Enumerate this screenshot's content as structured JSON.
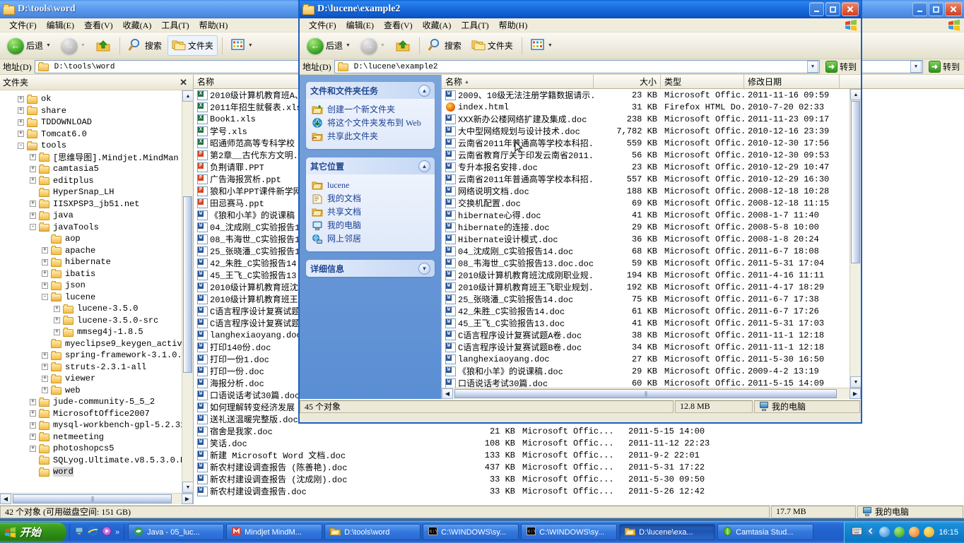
{
  "bg_window": {
    "title": "D:\\tools\\word",
    "menu": [
      "文件(F)",
      "编辑(E)",
      "查看(V)",
      "收藏(A)",
      "工具(T)",
      "帮助(H)"
    ],
    "toolbar": {
      "back": "后退",
      "search": "搜索",
      "folders": "文件夹"
    },
    "address": {
      "label": "地址(D)",
      "value": "D:\\tools\\word",
      "go": "转到"
    },
    "tree_header": "文件夹",
    "tree": [
      {
        "label": "ok",
        "indent": 1,
        "toggle": "+",
        "open": false
      },
      {
        "label": "share",
        "indent": 1,
        "toggle": "+",
        "open": false
      },
      {
        "label": "TDDOWNLOAD",
        "indent": 1,
        "toggle": "+",
        "open": false
      },
      {
        "label": "Tomcat6.0",
        "indent": 1,
        "toggle": "+",
        "open": false
      },
      {
        "label": "tools",
        "indent": 1,
        "toggle": "-",
        "open": true
      },
      {
        "label": "[思维导图].Mindjet.MindMan",
        "indent": 2,
        "toggle": "+",
        "open": false
      },
      {
        "label": "camtasia5",
        "indent": 2,
        "toggle": "+",
        "open": false
      },
      {
        "label": "editplus",
        "indent": 2,
        "toggle": "+",
        "open": false
      },
      {
        "label": "HyperSnap_LH",
        "indent": 2,
        "toggle": "",
        "open": false
      },
      {
        "label": "IISXPSP3_jb51.net",
        "indent": 2,
        "toggle": "+",
        "open": false
      },
      {
        "label": "java",
        "indent": 2,
        "toggle": "+",
        "open": false
      },
      {
        "label": "javaTools",
        "indent": 2,
        "toggle": "-",
        "open": true
      },
      {
        "label": "aop",
        "indent": 3,
        "toggle": "",
        "open": false
      },
      {
        "label": "apache",
        "indent": 3,
        "toggle": "+",
        "open": false
      },
      {
        "label": "hibernate",
        "indent": 3,
        "toggle": "+",
        "open": false
      },
      {
        "label": "ibatis",
        "indent": 3,
        "toggle": "+",
        "open": false
      },
      {
        "label": "json",
        "indent": 3,
        "toggle": "+",
        "open": false
      },
      {
        "label": "lucene",
        "indent": 3,
        "toggle": "-",
        "open": true
      },
      {
        "label": "lucene-3.5.0",
        "indent": 4,
        "toggle": "+",
        "open": false
      },
      {
        "label": "lucene-3.5.0-src",
        "indent": 4,
        "toggle": "+",
        "open": false
      },
      {
        "label": "mmseg4j-1.8.5",
        "indent": 4,
        "toggle": "+",
        "open": false
      },
      {
        "label": "myeclipse9_keygen_activ",
        "indent": 3,
        "toggle": "",
        "open": false
      },
      {
        "label": "spring-framework-3.1.0.",
        "indent": 3,
        "toggle": "+",
        "open": false
      },
      {
        "label": "struts-2.3.1-all",
        "indent": 3,
        "toggle": "+",
        "open": false
      },
      {
        "label": "viewer",
        "indent": 3,
        "toggle": "+",
        "open": false
      },
      {
        "label": "web",
        "indent": 3,
        "toggle": "+",
        "open": false
      },
      {
        "label": "jude-community-5_5_2",
        "indent": 2,
        "toggle": "+",
        "open": false
      },
      {
        "label": "MicrosoftOffice2007",
        "indent": 2,
        "toggle": "+",
        "open": false
      },
      {
        "label": "mysql-workbench-gpl-5.2.31",
        "indent": 2,
        "toggle": "+",
        "open": false
      },
      {
        "label": "netmeeting",
        "indent": 2,
        "toggle": "+",
        "open": false
      },
      {
        "label": "photoshopcs5",
        "indent": 2,
        "toggle": "+",
        "open": false
      },
      {
        "label": "SQLyog.Ultimate.v8.5.3.0.R",
        "indent": 2,
        "toggle": "",
        "open": false
      },
      {
        "label": "word",
        "indent": 2,
        "toggle": "",
        "open": false,
        "selected": true
      }
    ],
    "columns": {
      "name": "名称",
      "size": "大小",
      "type": "类型",
      "modified": "修改日期"
    },
    "files": [
      {
        "name": "2010级计算机教育班A、",
        "icon": "xls",
        "size": "",
        "type": "",
        "modified": ""
      },
      {
        "name": "2011年招生就餐表.xls",
        "icon": "xls",
        "size": "",
        "type": "",
        "modified": ""
      },
      {
        "name": "Book1.xls",
        "icon": "xls",
        "size": "",
        "type": "",
        "modified": ""
      },
      {
        "name": "学号.xls",
        "icon": "xls",
        "size": "",
        "type": "",
        "modified": ""
      },
      {
        "name": "昭通师范高等专科学校",
        "icon": "xls",
        "size": "",
        "type": "",
        "modified": ""
      },
      {
        "name": "第2章__古代东方文明.",
        "icon": "ppt",
        "size": "",
        "type": "",
        "modified": ""
      },
      {
        "name": "负荆请罪.PPT",
        "icon": "ppt",
        "size": "",
        "type": "",
        "modified": ""
      },
      {
        "name": "广告海报赏析.ppt",
        "icon": "ppt",
        "size": "",
        "type": "",
        "modified": ""
      },
      {
        "name": "狼和小羊PPT课件新学网",
        "icon": "ppt",
        "size": "",
        "type": "",
        "modified": ""
      },
      {
        "name": "田忌赛马.ppt",
        "icon": "ppt",
        "size": "",
        "type": "",
        "modified": ""
      },
      {
        "name": "《狼和小羊》的说课稿",
        "icon": "word",
        "size": "",
        "type": "",
        "modified": ""
      },
      {
        "name": "04_沈成刚_C实验报告1",
        "icon": "word",
        "size": "",
        "type": "",
        "modified": ""
      },
      {
        "name": "08_韦海世_C实验报告1",
        "icon": "word",
        "size": "",
        "type": "",
        "modified": ""
      },
      {
        "name": "25_张晓潘_C实验报告1",
        "icon": "word",
        "size": "",
        "type": "",
        "modified": ""
      },
      {
        "name": "42_朱胜_C实验报告14.",
        "icon": "word",
        "size": "",
        "type": "",
        "modified": ""
      },
      {
        "name": "45_王飞_C实验报告13.",
        "icon": "word",
        "size": "",
        "type": "",
        "modified": ""
      },
      {
        "name": "2010级计算机教育班沈",
        "icon": "word",
        "size": "",
        "type": "",
        "modified": ""
      },
      {
        "name": "2010级计算机教育班王",
        "icon": "word",
        "size": "",
        "type": "",
        "modified": ""
      },
      {
        "name": "C语言程序设计复赛试题",
        "icon": "word",
        "size": "",
        "type": "",
        "modified": ""
      },
      {
        "name": "C语言程序设计复赛试题",
        "icon": "word",
        "size": "",
        "type": "",
        "modified": ""
      },
      {
        "name": "langhexiaoyang.doc",
        "icon": "word",
        "size": "",
        "type": "",
        "modified": ""
      },
      {
        "name": "打印140份.doc",
        "icon": "word",
        "size": "",
        "type": "",
        "modified": ""
      },
      {
        "name": "打印一份1.doc",
        "icon": "word",
        "size": "",
        "type": "",
        "modified": ""
      },
      {
        "name": "打印一份.doc",
        "icon": "word",
        "size": "",
        "type": "",
        "modified": ""
      },
      {
        "name": "海报分析.doc",
        "icon": "word",
        "size": "",
        "type": "",
        "modified": ""
      },
      {
        "name": "口语说话考试30篇.doc",
        "icon": "word",
        "size": "",
        "type": "",
        "modified": ""
      },
      {
        "name": "如何理解转变经济发展",
        "icon": "word",
        "size": "",
        "type": "",
        "modified": ""
      },
      {
        "name": "送礼送温暖完整版.doc",
        "icon": "word",
        "size": "",
        "type": "",
        "modified": ""
      },
      {
        "name": "宿舍是我家.doc",
        "icon": "word",
        "size": "21 KB",
        "type": "Microsoft Offic...",
        "modified": "2011-5-15 14:00"
      },
      {
        "name": "笑话.doc",
        "icon": "word",
        "size": "108 KB",
        "type": "Microsoft Offic...",
        "modified": "2011-11-12 22:23"
      },
      {
        "name": "新建 Microsoft Word 文档.doc",
        "icon": "word",
        "size": "133 KB",
        "type": "Microsoft Offic...",
        "modified": "2011-9-2 22:01"
      },
      {
        "name": "新农村建设调查报告 (陈善艳).doc",
        "icon": "word",
        "size": "437 KB",
        "type": "Microsoft Offic...",
        "modified": "2011-5-31 17:22"
      },
      {
        "name": "新农村建设调查报告 (沈成刚).doc",
        "icon": "word",
        "size": "33 KB",
        "type": "Microsoft Offic...",
        "modified": "2011-5-30 09:50"
      },
      {
        "name": "新农村建设调查报告.doc",
        "icon": "word",
        "size": "33 KB",
        "type": "Microsoft Offic...",
        "modified": "2011-5-26 12:42"
      }
    ],
    "status": {
      "objects": "42 个对象 (可用磁盘空间: 151 GB)",
      "size": "17.7 MB",
      "location": "我的电脑"
    }
  },
  "fg_window": {
    "title": "D:\\lucene\\example2",
    "menu": [
      "文件(F)",
      "编辑(E)",
      "查看(V)",
      "收藏(A)",
      "工具(T)",
      "帮助(H)"
    ],
    "toolbar": {
      "back": "后退",
      "search": "搜索",
      "folders": "文件夹"
    },
    "address": {
      "label": "地址(D)",
      "value": "D:\\lucene\\example2",
      "go": "转到"
    },
    "taskpane": {
      "panel1": {
        "title": "文件和文件夹任务",
        "links": [
          {
            "label": "创建一个新文件夹",
            "icon": "new-folder-icon"
          },
          {
            "label": "将这个文件夹发布到 Web",
            "icon": "publish-web-icon"
          },
          {
            "label": "共享此文件夹",
            "icon": "share-folder-icon"
          }
        ]
      },
      "panel2": {
        "title": "其它位置",
        "links": [
          {
            "label": "lucene",
            "icon": "folder-icon"
          },
          {
            "label": "我的文档",
            "icon": "my-documents-icon"
          },
          {
            "label": "共享文档",
            "icon": "shared-documents-icon"
          },
          {
            "label": "我的电脑",
            "icon": "my-computer-icon"
          },
          {
            "label": "网上邻居",
            "icon": "network-icon"
          }
        ]
      },
      "panel3": {
        "title": "详细信息"
      }
    },
    "columns": {
      "name": "名称",
      "size": "大小",
      "type": "类型",
      "modified": "修改日期"
    },
    "files": [
      {
        "name": "2009、10级无法注册学籍数据请示.doc",
        "icon": "word",
        "size": "23 KB",
        "type": "Microsoft Offic...",
        "modified": "2011-11-16 09:59"
      },
      {
        "name": "index.html",
        "icon": "firefox",
        "size": "31 KB",
        "type": "Firefox HTML Do...",
        "modified": "2010-7-20 02:33"
      },
      {
        "name": "XXX新办公楼网络扩建及集成.doc",
        "icon": "word",
        "size": "238 KB",
        "type": "Microsoft Offic...",
        "modified": "2011-11-23 09:17"
      },
      {
        "name": "大中型网络规划与设计技术.doc",
        "icon": "word",
        "size": "7,782 KB",
        "type": "Microsoft Offic...",
        "modified": "2010-12-16 23:39"
      },
      {
        "name": "云南省2011年普通高等学校本科招...",
        "icon": "word",
        "size": "559 KB",
        "type": "Microsoft Offic...",
        "modified": "2010-12-30 17:56"
      },
      {
        "name": "云南省教育厅关于印发云南省2011...",
        "icon": "word",
        "size": "56 KB",
        "type": "Microsoft Offic...",
        "modified": "2010-12-30 09:53"
      },
      {
        "name": "专升本报名安排.doc",
        "icon": "word",
        "size": "23 KB",
        "type": "Microsoft Offic...",
        "modified": "2010-12-29 10:47"
      },
      {
        "name": "云南省2011年普通高等学校本科招...",
        "icon": "word",
        "size": "557 KB",
        "type": "Microsoft Offic...",
        "modified": "2010-12-29 16:30"
      },
      {
        "name": "网络说明文档.doc",
        "icon": "word",
        "size": "188 KB",
        "type": "Microsoft Offic...",
        "modified": "2008-12-18 10:28"
      },
      {
        "name": "交换机配置.doc",
        "icon": "word",
        "size": "69 KB",
        "type": "Microsoft Offic...",
        "modified": "2008-12-18 11:15"
      },
      {
        "name": "hibernate心得.doc",
        "icon": "word",
        "size": "41 KB",
        "type": "Microsoft Offic...",
        "modified": "2008-1-7 11:40"
      },
      {
        "name": "hibernate的连接.doc",
        "icon": "word",
        "size": "29 KB",
        "type": "Microsoft Offic...",
        "modified": "2008-5-8 10:00"
      },
      {
        "name": "Hibernate设计模式.doc",
        "icon": "word",
        "size": "36 KB",
        "type": "Microsoft Offic...",
        "modified": "2008-1-8 20:24"
      },
      {
        "name": "04_沈成刚_C实验报告14.doc",
        "icon": "word",
        "size": "68 KB",
        "type": "Microsoft Offic...",
        "modified": "2011-6-7 18:08"
      },
      {
        "name": "08_韦海世_C实验报告13.doc.doc",
        "icon": "word",
        "size": "59 KB",
        "type": "Microsoft Offic...",
        "modified": "2011-5-31 17:04"
      },
      {
        "name": "2010级计算机教育班沈成刚职业规...",
        "icon": "word",
        "size": "194 KB",
        "type": "Microsoft Offic...",
        "modified": "2011-4-16 11:11"
      },
      {
        "name": "2010级计算机教育班王飞职业规划.doc",
        "icon": "word",
        "size": "192 KB",
        "type": "Microsoft Offic...",
        "modified": "2011-4-17 18:29"
      },
      {
        "name": "25_张晓潘_C实验报告14.doc",
        "icon": "word",
        "size": "75 KB",
        "type": "Microsoft Offic...",
        "modified": "2011-6-7 17:38"
      },
      {
        "name": "42_朱胜_C实验报告14.doc",
        "icon": "word",
        "size": "61 KB",
        "type": "Microsoft Offic...",
        "modified": "2011-6-7 17:26"
      },
      {
        "name": "45_王飞_C实验报告13.doc",
        "icon": "word",
        "size": "41 KB",
        "type": "Microsoft Offic...",
        "modified": "2011-5-31 17:03"
      },
      {
        "name": "C语言程序设计复赛试题A卷.doc",
        "icon": "word",
        "size": "38 KB",
        "type": "Microsoft Offic...",
        "modified": "2011-11-1 12:18"
      },
      {
        "name": "C语言程序设计复赛试题B卷.doc",
        "icon": "word",
        "size": "34 KB",
        "type": "Microsoft Offic...",
        "modified": "2011-11-1 12:18"
      },
      {
        "name": "langhexiaoyang.doc",
        "icon": "word",
        "size": "27 KB",
        "type": "Microsoft Offic...",
        "modified": "2011-5-30 16:50"
      },
      {
        "name": "《狼和小羊》的说课稿.doc",
        "icon": "word",
        "size": "29 KB",
        "type": "Microsoft Offic...",
        "modified": "2009-4-2 13:19"
      },
      {
        "name": "口语说话考试30篇.doc",
        "icon": "word",
        "size": "60 KB",
        "type": "Microsoft Offic...",
        "modified": "2011-5-15 14:09"
      }
    ],
    "status": {
      "objects": "45 个对象",
      "size": "12.8 MB",
      "location": "我的电脑"
    }
  },
  "taskbar": {
    "start": "开始",
    "quicklaunch": [
      "show-desktop-icon",
      "internet-explorer-icon",
      "media-player-icon",
      "chevron-right-icon"
    ],
    "tasks": [
      {
        "label": "Java - 05_luc...",
        "icon": "eclipse-icon",
        "active": false
      },
      {
        "label": "Mindjet MindM...",
        "icon": "mindjet-icon",
        "active": false
      },
      {
        "label": "D:\\tools\\word",
        "icon": "folder-icon",
        "active": false
      },
      {
        "label": "C:\\WINDOWS\\sy...",
        "icon": "console-icon",
        "active": false
      },
      {
        "label": "C:\\WINDOWS\\sy...",
        "icon": "console-icon",
        "active": false
      },
      {
        "label": "D:\\lucene\\exa...",
        "icon": "folder-icon",
        "active": true
      },
      {
        "label": "Camtasia Stud...",
        "icon": "camtasia-icon",
        "active": false
      }
    ],
    "clock": "16:15"
  },
  "colors": {
    "titlebar_active": "#0a5fce",
    "titlebar_inactive": "#5a9cf0",
    "taskpane_blue": "#6d9ad8",
    "desktop": "#3a6ea5",
    "link_blue": "#1c3f94",
    "start_green": "#3a9a1c"
  }
}
